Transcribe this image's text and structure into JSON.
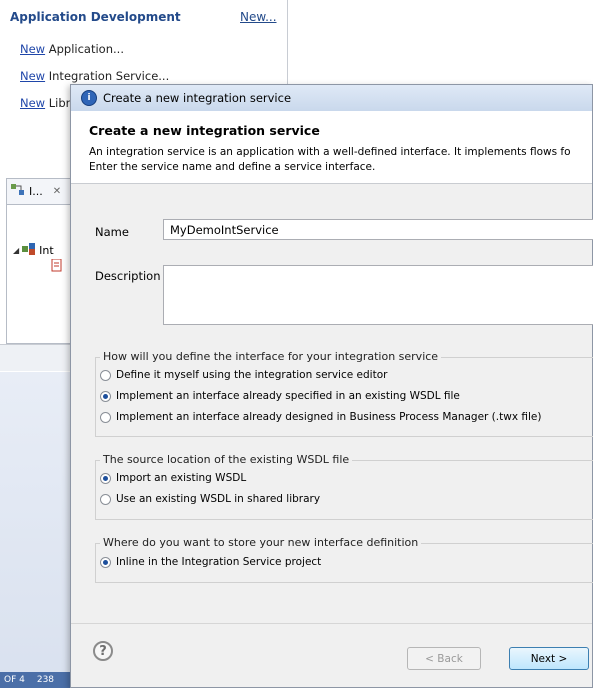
{
  "app_dev": {
    "title": "Application Development",
    "new_link": "New...",
    "items": [
      {
        "link": "New",
        "rest": " Application..."
      },
      {
        "link": "New",
        "rest": " Integration Service..."
      },
      {
        "link": "New",
        "rest": " Libra"
      }
    ]
  },
  "view": {
    "tab_label": "I...",
    "tree_item": "Int"
  },
  "status": {
    "left": "OF 4",
    "right": "238"
  },
  "dialog": {
    "window_title": "Create a new integration service",
    "header_title": "Create a new integration service",
    "header_desc_1": "An integration service is an application with a well-defined interface. It implements flows fo",
    "header_desc_2": "Enter the service name and define a service interface.",
    "name_label": "Name",
    "name_value": "MyDemoIntService",
    "description_label": "Description",
    "description_value": "",
    "define_group": {
      "legend": "How will you define the interface for your integration service",
      "options": [
        {
          "label": "Define it myself using the integration service editor",
          "checked": false
        },
        {
          "label": "Implement an interface already specified in an existing WSDL file",
          "checked": true
        },
        {
          "label": "Implement an interface already designed in Business Process Manager (.twx file)",
          "checked": false
        }
      ]
    },
    "source_group": {
      "legend": "The source location of the existing WSDL file",
      "options": [
        {
          "label": "Import an existing WSDL",
          "checked": true
        },
        {
          "label": "Use an existing WSDL in shared library",
          "checked": false
        }
      ]
    },
    "store_group": {
      "legend": "Where do you want to store your new interface definition",
      "options": [
        {
          "label": "Inline in the Integration Service project",
          "checked": true
        }
      ]
    },
    "help_symbol": "?",
    "back_label": "< Back",
    "next_label": "Next >"
  }
}
